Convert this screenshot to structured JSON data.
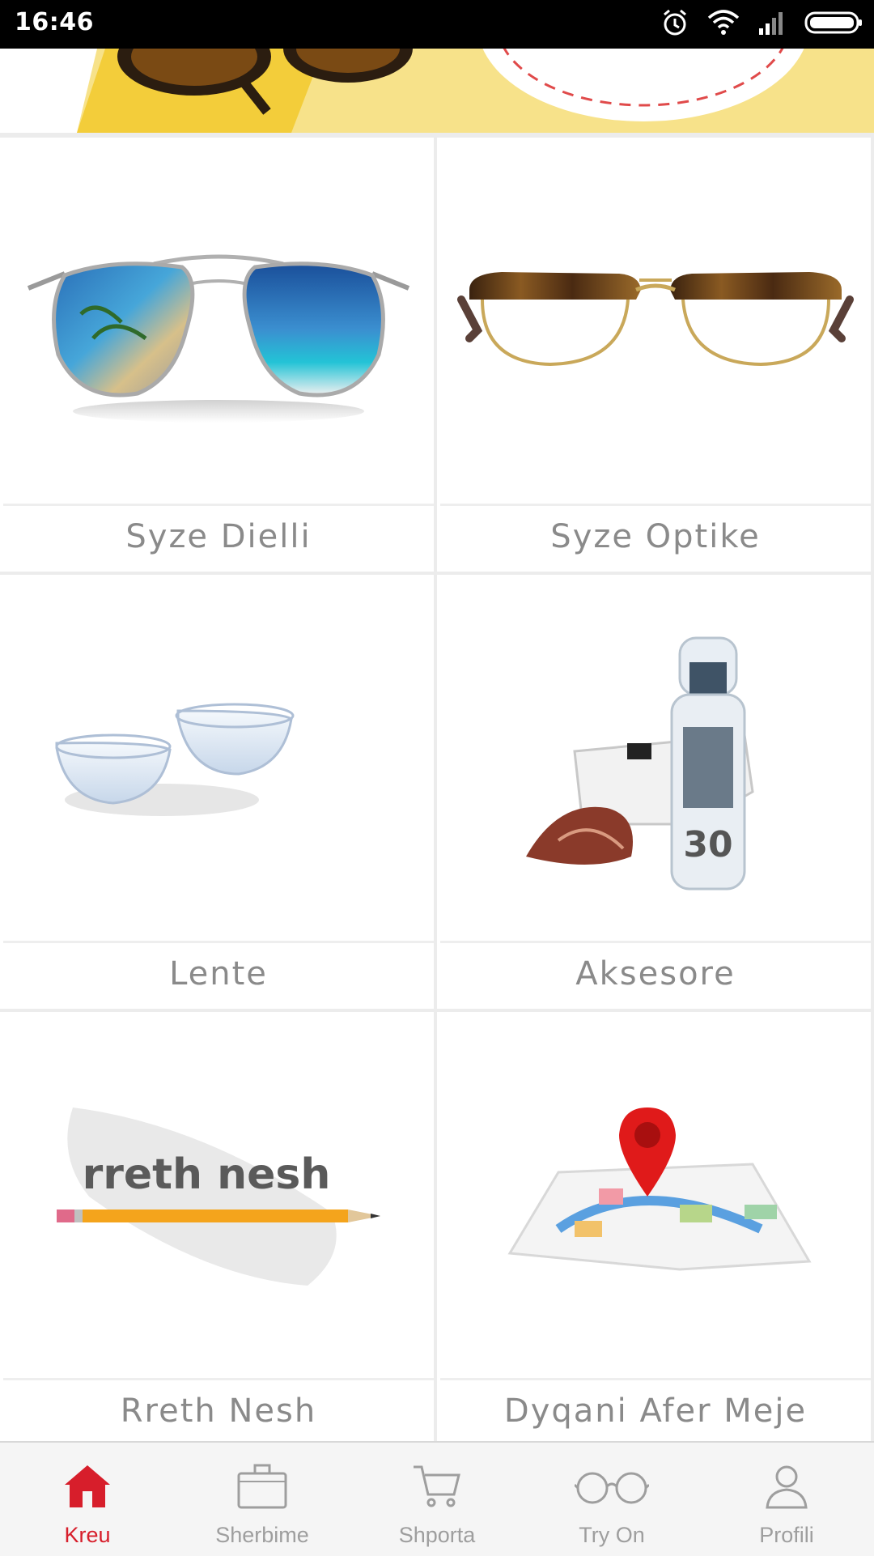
{
  "status_bar": {
    "time": "16:46"
  },
  "banner": {
    "active_slide": 2,
    "slide_count": 3
  },
  "tiles": [
    {
      "label": "Syze Dielli",
      "image": "aviator-sunglasses"
    },
    {
      "label": "Syze Optike",
      "image": "optical-glasses"
    },
    {
      "label": "Lente",
      "image": "contact-lenses"
    },
    {
      "label": "Aksesore",
      "image": "cleaning-spray-accessories"
    },
    {
      "label": "Rreth Nesh",
      "image": "about-us-pencil",
      "image_text": "rreth nesh"
    },
    {
      "label": "Dyqani Afer Meje",
      "image": "map-pin"
    }
  ],
  "bottom_nav": [
    {
      "label": "Kreu",
      "icon": "home-icon",
      "active": true
    },
    {
      "label": "Sherbime",
      "icon": "briefcase-icon",
      "active": false
    },
    {
      "label": "Shporta",
      "icon": "cart-icon",
      "active": false
    },
    {
      "label": "Try On",
      "icon": "glasses-icon",
      "active": false
    },
    {
      "label": "Profili",
      "icon": "user-icon",
      "active": false
    }
  ],
  "colors": {
    "accent": "#d71e2b",
    "inactive": "#9e9e9e",
    "label": "#8a8a8a"
  }
}
